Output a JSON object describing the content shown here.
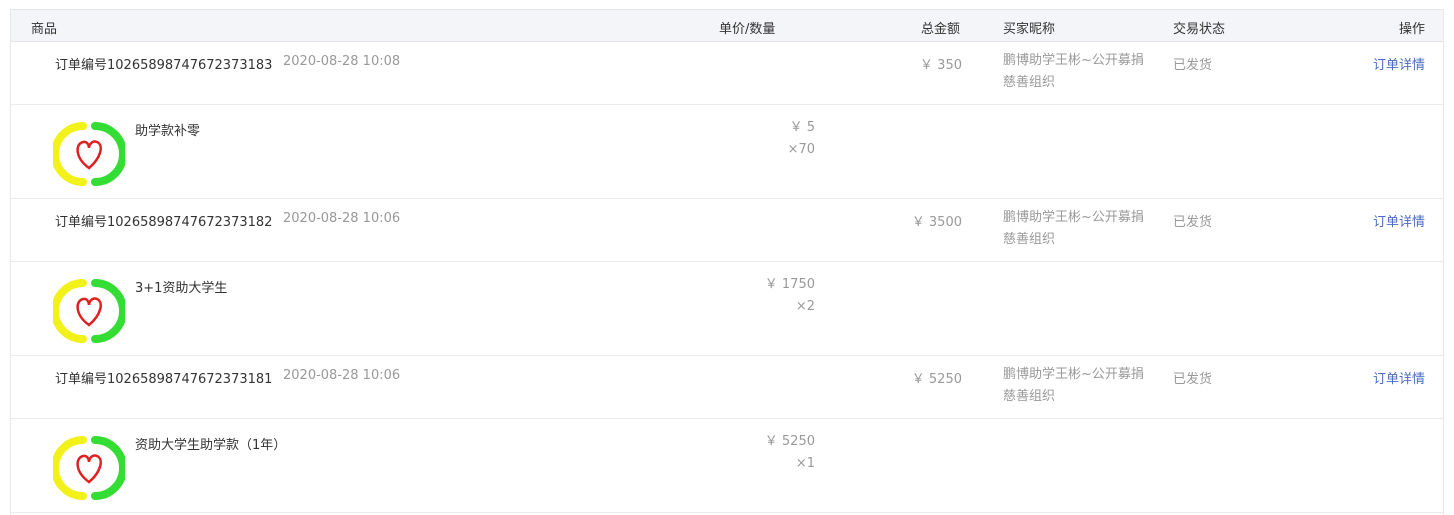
{
  "header": {
    "product": "商品",
    "unit_qty": "单价/数量",
    "total": "总金额",
    "buyer": "买家昵称",
    "status": "交易状态",
    "action": "操作"
  },
  "orders": [
    {
      "order_no": "订单编号10265898747672373183",
      "date": "2020-08-28 10:08",
      "total": "￥ 350",
      "buyer": "鹏博助学王彬~公开募捐慈善组织",
      "status": "已发货",
      "detail": "订单详情",
      "product_name": "助学款补零",
      "price": "￥ 5",
      "qty": "×70"
    },
    {
      "order_no": "订单编号10265898747672373182",
      "date": "2020-08-28 10:06",
      "total": "￥ 3500",
      "buyer": "鹏博助学王彬~公开募捐慈善组织",
      "status": "已发货",
      "detail": "订单详情",
      "product_name": "3+1资助大学生",
      "price": "￥ 1750",
      "qty": "×2"
    },
    {
      "order_no": "订单编号10265898747672373181",
      "date": "2020-08-28 10:06",
      "total": "￥ 5250",
      "buyer": "鹏博助学王彬~公开募捐慈善组织",
      "status": "已发货",
      "detail": "订单详情",
      "product_name": "资助大学生助学款（1年）",
      "price": "￥ 5250",
      "qty": "×1"
    }
  ],
  "colors": {
    "header_bg": "#f4f5f8",
    "link": "#4a6bbf",
    "muted": "#999999",
    "logo_yellow": "#f2f21a",
    "logo_green": "#33dd33",
    "logo_heart": "#e02020"
  }
}
